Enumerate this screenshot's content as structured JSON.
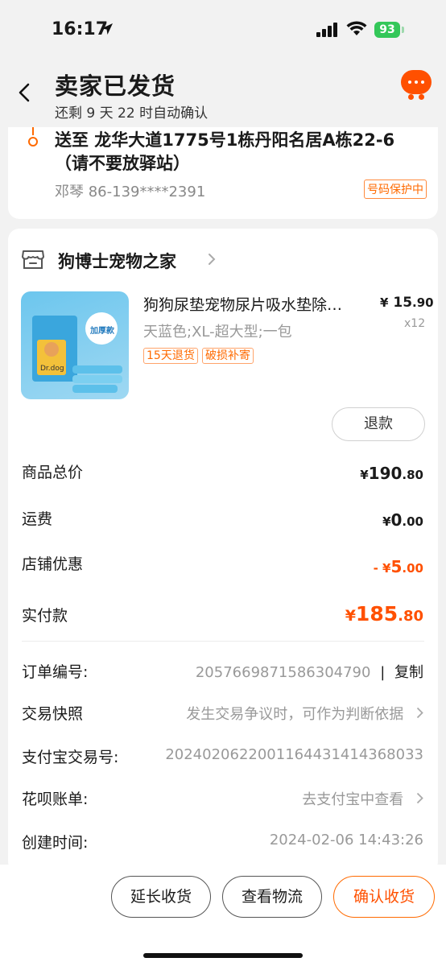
{
  "status": {
    "time": "16:17",
    "battery": "93"
  },
  "header": {
    "title": "卖家已发货",
    "subtitle": "还剩 9 天 22 时自动确认"
  },
  "address": {
    "text": "送至 龙华大道1775号1栋丹阳名居A栋22-6（请不要放驿站）",
    "contact": "邓琴 86-139****2391",
    "protect": "号码保护中"
  },
  "shop": {
    "name": "狗博士宠物之家"
  },
  "product": {
    "name": "狗狗尿垫宠物尿片吸水垫除…",
    "price_yen": "¥",
    "price_int": "15",
    "price_dec": ".90",
    "qty": "x12",
    "spec": "天蓝色;XL-超大型;一包",
    "tags": [
      "15天退货",
      "破损补寄"
    ],
    "refund": "退款",
    "thumb_badge": "加厚款",
    "thumb_brand": "Dr.dog"
  },
  "summary": [
    {
      "label": "商品总价",
      "prefix": "¥",
      "int": "190",
      "dec": ".80"
    },
    {
      "label": "运费",
      "prefix": "¥",
      "int": "0",
      "dec": ".00"
    },
    {
      "label": "店铺优惠",
      "prefix": "- ¥",
      "int": "5",
      "dec": ".00"
    },
    {
      "label": "实付款",
      "prefix": "¥",
      "int": "185",
      "dec": ".80"
    }
  ],
  "info": [
    {
      "label": "订单编号:",
      "value": "2057669871586304790",
      "action": "复制"
    },
    {
      "label": "交易快照",
      "value": "发生交易争议时，可作为判断依据"
    },
    {
      "label": "支付宝交易号:",
      "value": "2024020622001164431414368033"
    },
    {
      "label": "花呗账单:",
      "value": "去支付宝中查看"
    },
    {
      "label": "创建时间:",
      "value": "2024-02-06 14:43:26"
    }
  ],
  "actions": {
    "extend": "延长收货",
    "logistics": "查看物流",
    "confirm": "确认收货"
  },
  "colors": {
    "accent": "#ff5000",
    "tag": "#ff6a00",
    "battery": "#34c759"
  }
}
